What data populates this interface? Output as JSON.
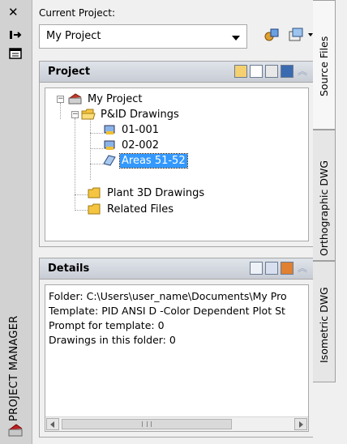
{
  "window": {
    "title": "PROJECT MANAGER"
  },
  "toolbar": {
    "current_project_label": "Current Project:",
    "current_project_value": "My Project",
    "buttons": [
      "project-setup-icon",
      "open-project-icon"
    ]
  },
  "project": {
    "header": "Project",
    "tree": {
      "root": "My Project",
      "pid_folder": "P&ID Drawings",
      "drawings": [
        "01-001",
        "02-002",
        "Areas 51-52"
      ],
      "selected": "Areas 51-52",
      "plant3d_folder": "Plant 3D Drawings",
      "related_folder": "Related Files"
    }
  },
  "details": {
    "header": "Details",
    "lines": [
      "Folder: C:\\Users\\user_name\\Documents\\My Pro",
      "Template: PID ANSI D -Color Dependent Plot St",
      "Prompt for template: 0",
      "Drawings in this folder: 0"
    ]
  },
  "tabs": [
    "Source Files",
    "Orthographic DWG",
    "Isometric DWG"
  ],
  "colors": {
    "selection": "#3399ff",
    "header_gradient_top": "#dfe3ea",
    "folder": "#f5c542"
  }
}
